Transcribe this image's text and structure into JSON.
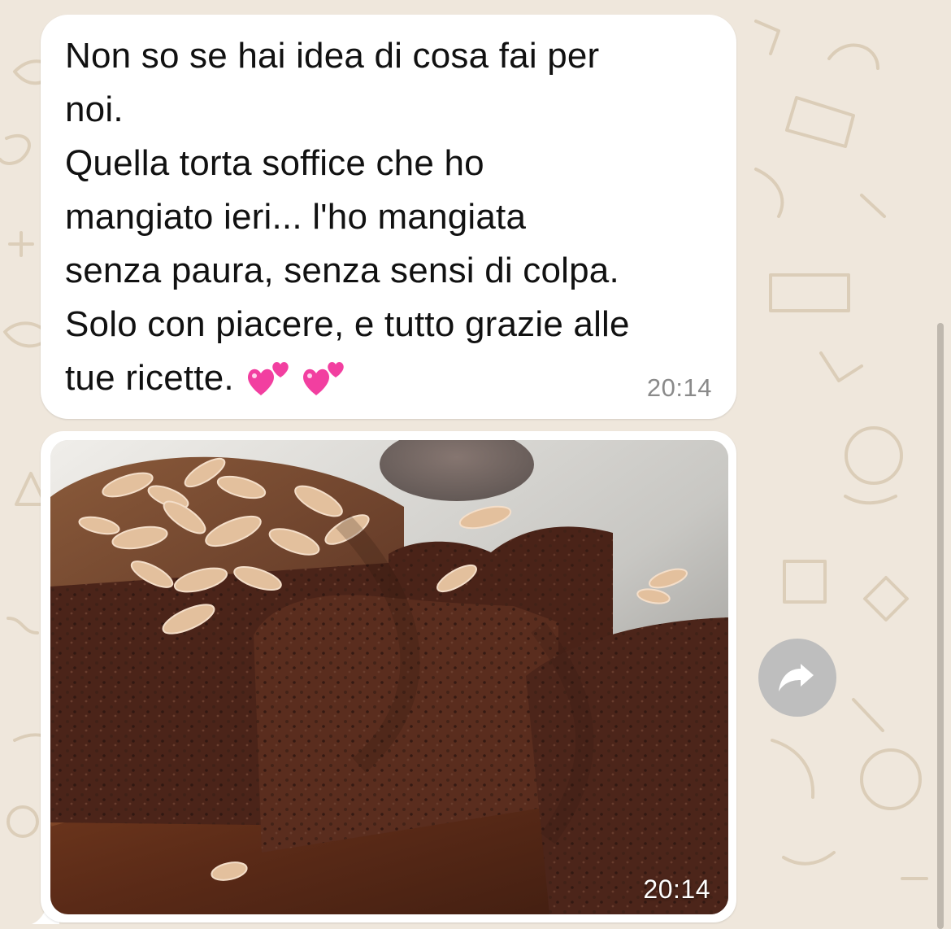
{
  "conversation": {
    "messages": [
      {
        "type": "text",
        "text": "Non so se hai idea di cosa fai per\nnoi.\nQuella torta soffice che ho\nmangiato ieri... l'ho mangiata\nsenza paura, senza sensi di colpa.\nSolo con piacere, e tutto grazie alle\ntue ricette.",
        "emojis": [
          "💕",
          "💕"
        ],
        "time": "20:14"
      },
      {
        "type": "image",
        "image_description": "slices of chocolate loaf cake topped with sliced almonds on a wooden board",
        "time": "20:14"
      }
    ]
  },
  "controls": {
    "forward_icon": "forward-arrow-icon"
  },
  "colors": {
    "background": "#efe7dc",
    "bubble": "#ffffff",
    "timestamp": "#8a8a8a",
    "forward_button": "#bebebe"
  }
}
